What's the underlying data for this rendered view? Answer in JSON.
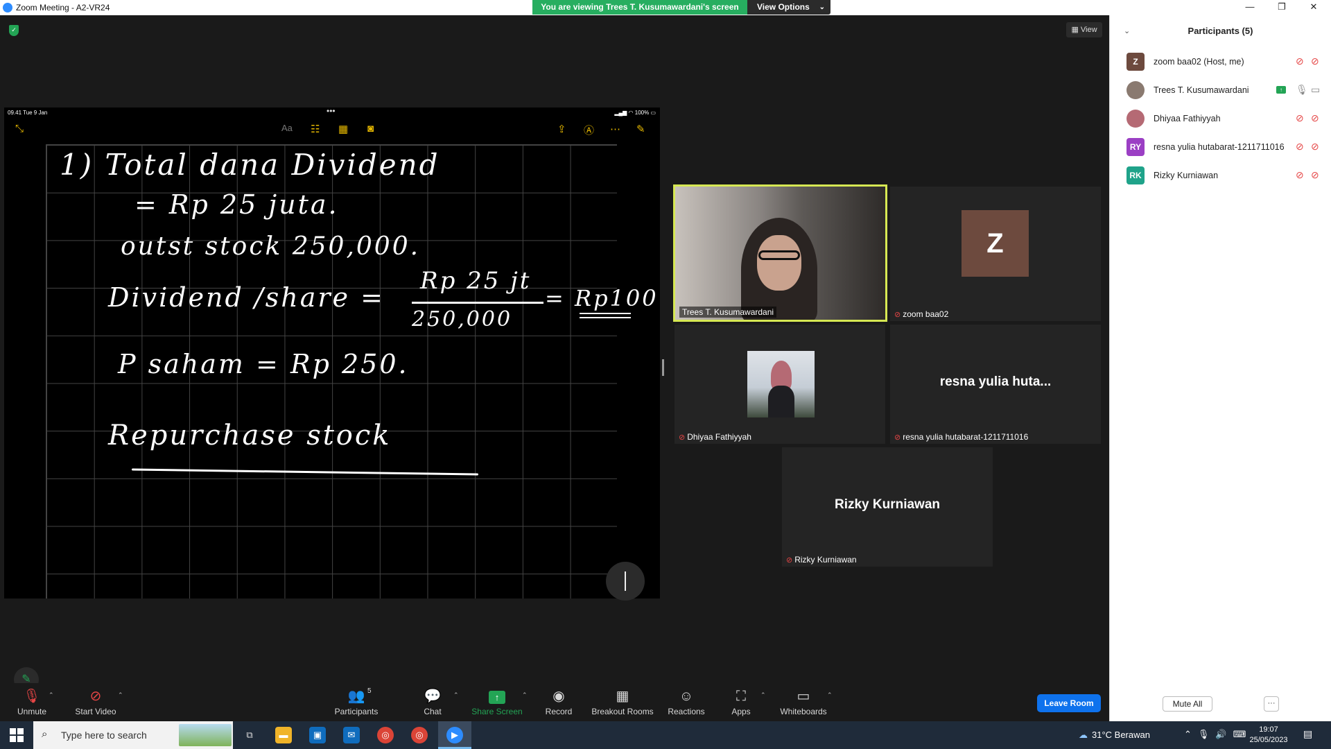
{
  "window": {
    "title": "Zoom Meeting - A2-VR24",
    "minimize": "—",
    "restore": "❐",
    "close": "✕"
  },
  "share_banner": {
    "text": "You are viewing Trees T. Kusumawardani's screen",
    "view_options": "View Options",
    "view_options_chevron": "⌄"
  },
  "view_button": "View",
  "shared_screen": {
    "status_time": "09.41  Tue 9 Jan",
    "status_battery": "100%",
    "toolbar_icons": [
      "collapse-icon",
      "text-format-icon",
      "checklist-icon",
      "table-icon",
      "camera-icon",
      "share-icon",
      "markup-icon",
      "more-icon",
      "compose-icon"
    ],
    "handwriting": {
      "line1": "1)  Total  dana  Dividend",
      "line2": "= Rp 25 juta.",
      "line3": "outst  stock  250,000.",
      "line4a": "Dividend /share =",
      "line4b": "Rp 25 jt",
      "line4c": "250,000",
      "line4d": "= Rp100",
      "line5": "P saham  =  Rp 250.",
      "line6": "Repurchase  stock"
    }
  },
  "tiles": {
    "trees": {
      "name": "Trees T. Kusumawardani"
    },
    "zoom": {
      "avatar_letter": "Z",
      "name": "zoom baa02"
    },
    "dhiyaa": {
      "name": "Dhiyaa Fathiyyah"
    },
    "resna": {
      "display": "resna yulia huta...",
      "name": "resna yulia hutabarat-1211711016"
    },
    "rizky": {
      "display": "Rizky Kurniawan",
      "name": "Rizky Kurniawan"
    }
  },
  "toolbar": {
    "unmute": "Unmute",
    "start_video": "Start Video",
    "participants": "Participants",
    "participants_count": "5",
    "chat": "Chat",
    "share_screen": "Share Screen",
    "record": "Record",
    "breakout_rooms": "Breakout Rooms",
    "reactions": "Reactions",
    "apps": "Apps",
    "whiteboards": "Whiteboards",
    "leave_room": "Leave Room"
  },
  "participants_panel": {
    "title": "Participants (5)",
    "items": [
      {
        "initials": "Z",
        "name": "zoom baa02 (Host, me)",
        "color": "#6d4a3e"
      },
      {
        "initials": "",
        "name": "Trees T. Kusumawardani",
        "color": "#8a7a70"
      },
      {
        "initials": "",
        "name": "Dhiyaa Fathiyyah",
        "color": "#b56a74"
      },
      {
        "initials": "RY",
        "name": "resna yulia hutabarat-1211711016",
        "color": "#9b3fc4"
      },
      {
        "initials": "RK",
        "name": "Rizky Kurniawan",
        "color": "#1fa38a"
      }
    ],
    "mute_all": "Mute All",
    "more": "···"
  },
  "taskbar": {
    "search_placeholder": "Type here to search",
    "weather": "31°C  Berawan",
    "time": "19:07",
    "date": "25/05/2023"
  },
  "colors": {
    "zoom_blue": "#0e72ed",
    "share_green": "#23a455",
    "active_speaker": "#d6e853",
    "muted_red": "#e54545"
  }
}
